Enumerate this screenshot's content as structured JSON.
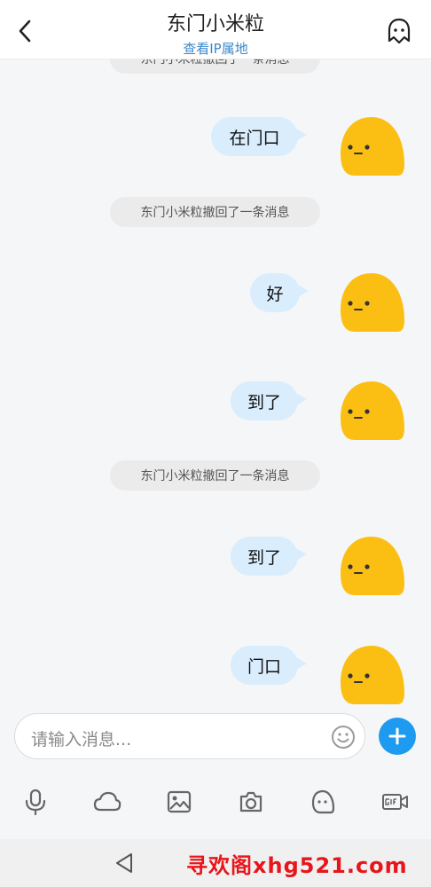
{
  "header": {
    "title": "东门小米粒",
    "subtitle": "查看IP属地",
    "back_icon": "chevron-left-icon",
    "profile_icon": "ghost-profile-icon"
  },
  "messages": [
    {
      "type": "system",
      "text": "东门小米粒撤回了一条消息"
    },
    {
      "type": "sent",
      "text": "在门口"
    },
    {
      "type": "system",
      "text": "东门小米粒撤回了一条消息"
    },
    {
      "type": "sent",
      "text": "好"
    },
    {
      "type": "sent",
      "text": "到了"
    },
    {
      "type": "system",
      "text": "东门小米粒撤回了一条消息"
    },
    {
      "type": "sent",
      "text": "到了"
    },
    {
      "type": "sent",
      "text": "门口"
    }
  ],
  "composer": {
    "placeholder": "请输入消息...",
    "emoji_icon": "smiley-icon",
    "plus_icon": "plus-icon",
    "tools": [
      "microphone-icon",
      "cloud-icon",
      "image-icon",
      "camera-icon",
      "ghost-icon",
      "gif-icon"
    ]
  },
  "navbar": {
    "back_icon": "triangle-back-icon",
    "watermark": "寻欢阁xhg521.com"
  },
  "colors": {
    "accent": "#1e9bf0",
    "bubble": "#d9edfd",
    "subtitle": "#3a87c9",
    "watermark": "#e8151a"
  }
}
